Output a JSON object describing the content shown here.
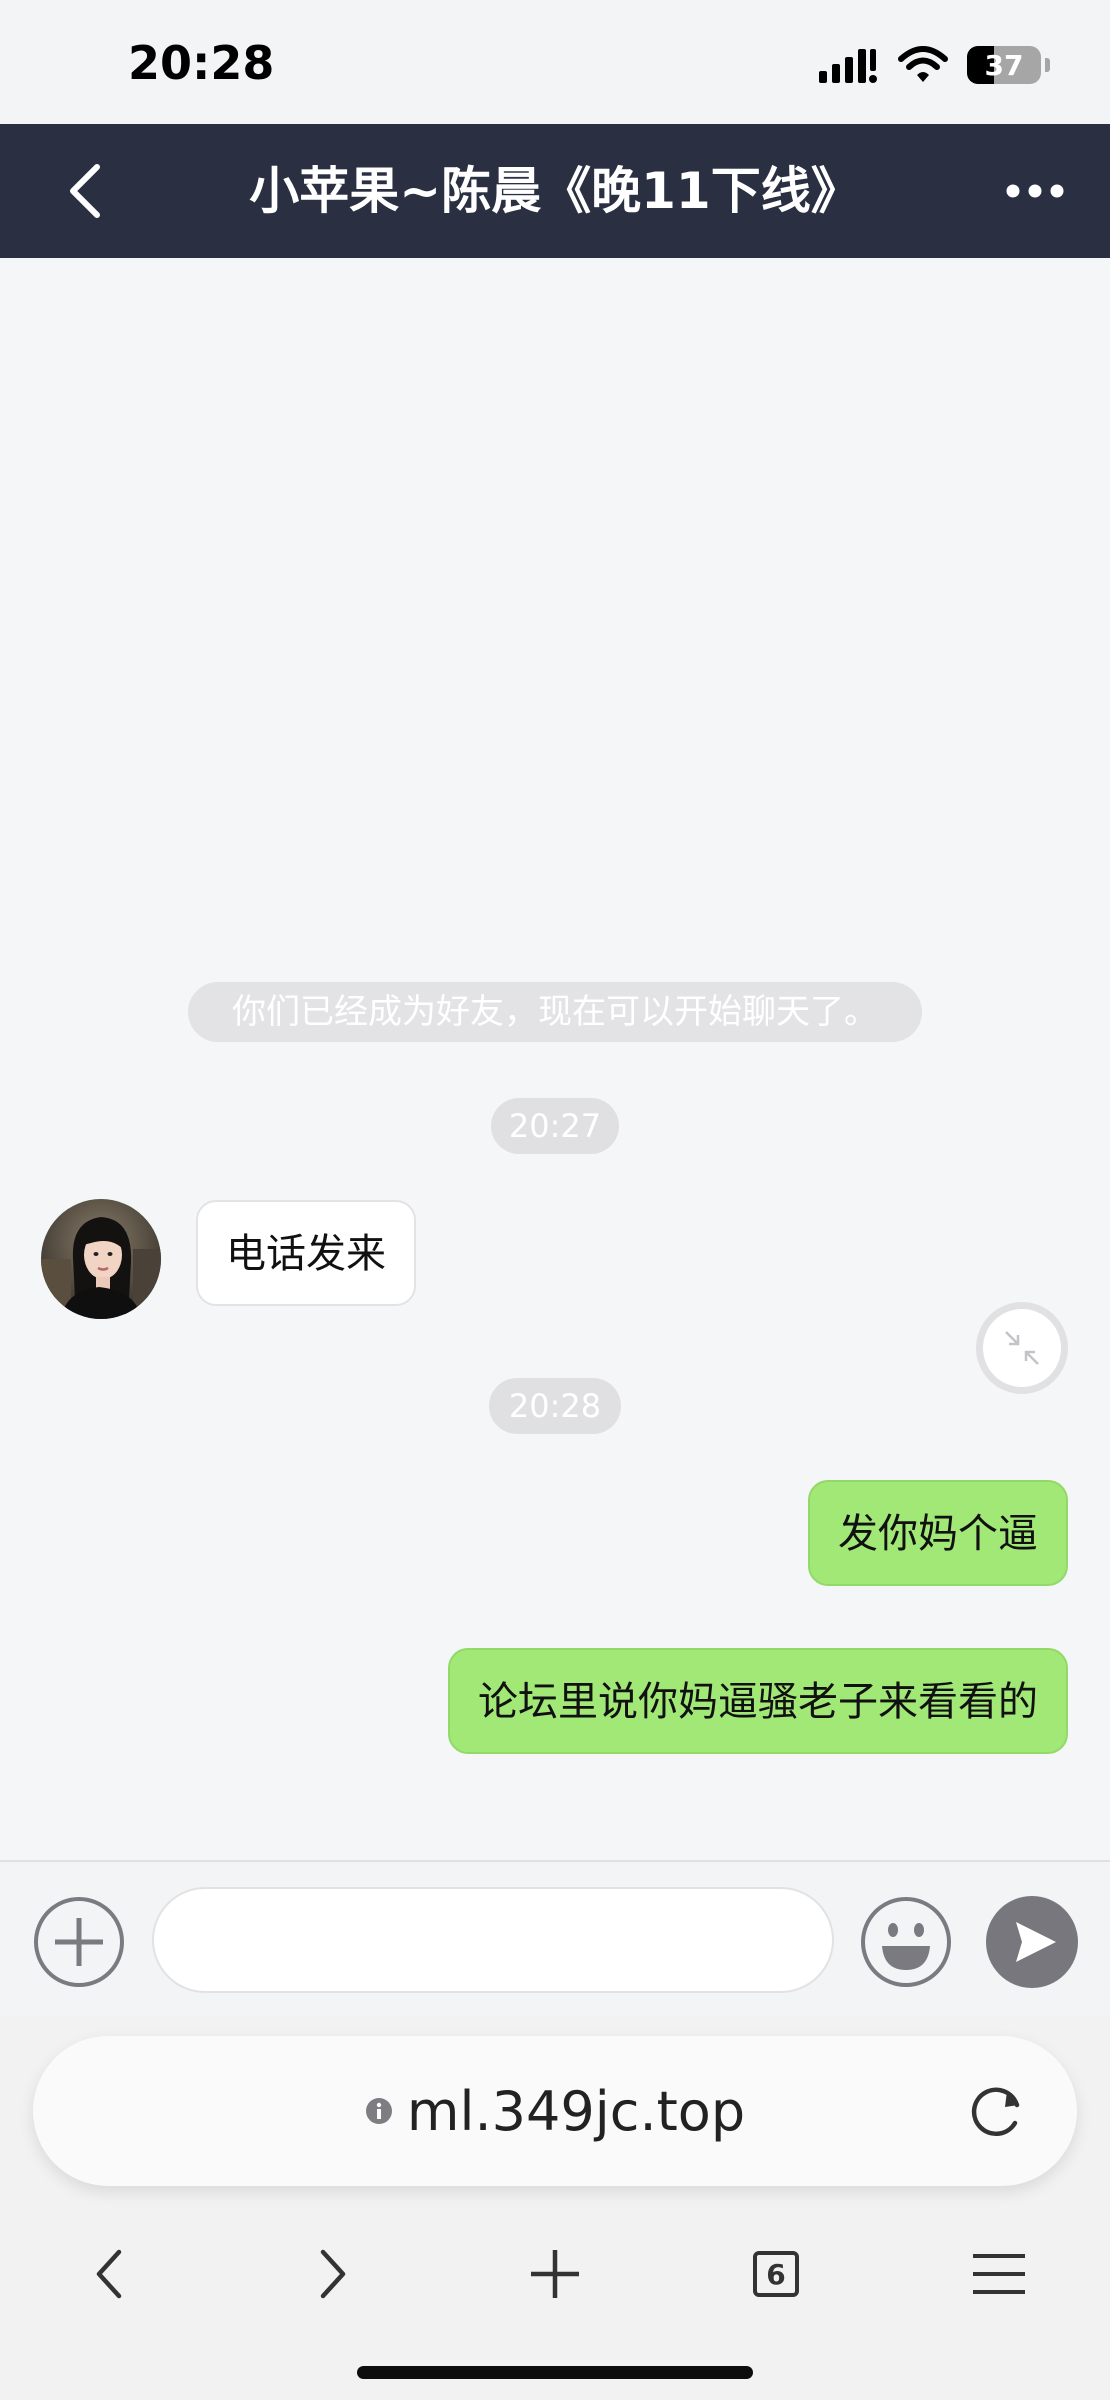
{
  "status_bar": {
    "time": "20:28",
    "battery_level": "37",
    "battery_fraction": 0.37,
    "icons": [
      "signal-icon",
      "wifi-icon",
      "battery-icon"
    ]
  },
  "header": {
    "title": "小苹果~陈晨《晚11下线》",
    "back_icon": "chevron-left-icon",
    "more_icon": "more-dots-icon"
  },
  "chat": {
    "system_notice": "你们已经成为好友，现在可以开始聊天了。",
    "timestamps": [
      "20:27",
      "20:28"
    ],
    "messages": [
      {
        "from": "contact",
        "text": "电话发来"
      },
      {
        "from": "me",
        "text": "发你妈个逼"
      },
      {
        "from": "me",
        "text": "论坛里说你妈逼骚老子来看看的"
      }
    ]
  },
  "input_bar": {
    "placeholder": "",
    "icons": [
      "plus-circle-icon",
      "smiley-icon",
      "send-arrow-icon"
    ]
  },
  "browser": {
    "url": "ml.349jc.top",
    "tab_count": "6",
    "toolbar_icons": [
      "back-arrow-icon",
      "forward-arrow-icon",
      "new-tab-icon",
      "tabs-icon",
      "menu-icon"
    ]
  },
  "colors": {
    "header_bg": "#2a2f42",
    "outgoing_bubble": "#a1e877",
    "incoming_bubble": "#ffffff",
    "chat_bg": "#f5f6f8",
    "send_button": "#77777d"
  }
}
